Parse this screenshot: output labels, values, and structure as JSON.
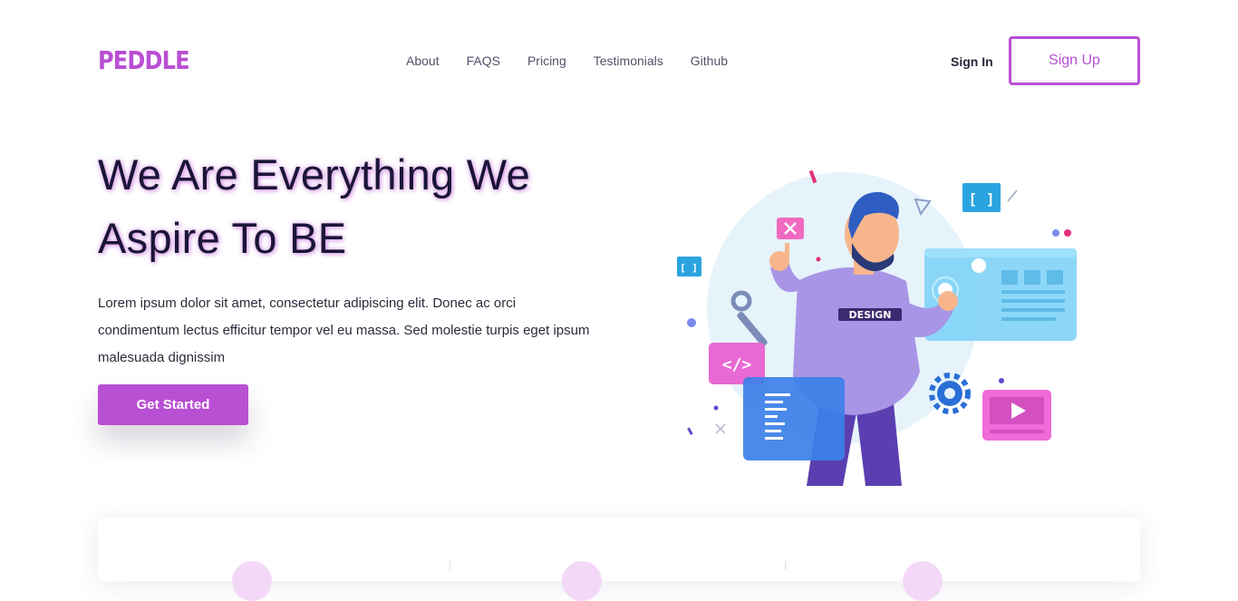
{
  "brand": {
    "logo_text": "PEDDLE"
  },
  "nav": {
    "items": [
      {
        "label": "About"
      },
      {
        "label": "FAQS"
      },
      {
        "label": "Pricing"
      },
      {
        "label": "Testimonials"
      },
      {
        "label": "Github"
      }
    ]
  },
  "auth": {
    "sign_in_label": "Sign In",
    "sign_up_label": "Sign Up"
  },
  "hero": {
    "title_line1": "We Are Everything We",
    "title_line2": "Aspire To BE",
    "description": "Lorem ipsum dolor sit amet, consectetur adipiscing elit. Donec ac orci condimentum lectus efficitur tempor vel eu massa. Sed molestie turpis eget ipsum malesuada dignissim",
    "cta_label": "Get Started"
  },
  "illustration": {
    "shirt_text": "DESIGN",
    "code_tag": "</>",
    "bracket_tag": "[ ]"
  },
  "colors": {
    "brand": "#b94fd3",
    "heading": "#1b1538"
  }
}
